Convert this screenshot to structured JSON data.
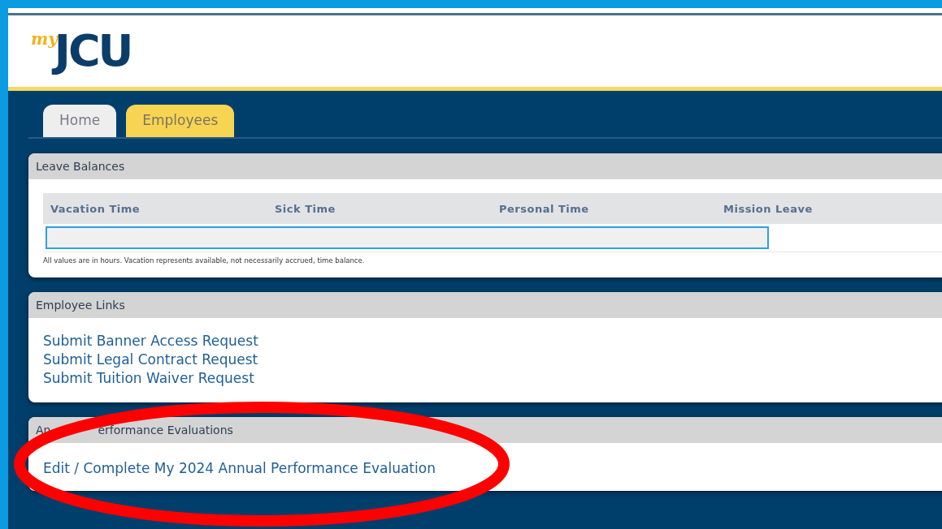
{
  "logo": {
    "prefix": "my",
    "name": "JCU"
  },
  "tabs": [
    {
      "label": "Home",
      "selected": false
    },
    {
      "label": "Employees",
      "selected": true
    }
  ],
  "leave_balances": {
    "title": "Leave Balances",
    "columns": [
      "Vacation Time",
      "Sick Time",
      "Personal Time",
      "Mission Leave"
    ],
    "note": "All values are in hours. Vacation represents available, not necessarily accrued, time balance."
  },
  "employee_links": {
    "title": "Employee Links",
    "links": [
      "Submit Banner Access Request",
      "Submit Legal Contract Request",
      "Submit Tuition Waiver Request"
    ]
  },
  "evaluations": {
    "title_parts": [
      "An",
      "erformance Evaluations"
    ],
    "links": [
      "Edit / Complete My 2024 Annual Performance Evaluation"
    ]
  },
  "annotation": {
    "kind": "ellipse"
  }
}
